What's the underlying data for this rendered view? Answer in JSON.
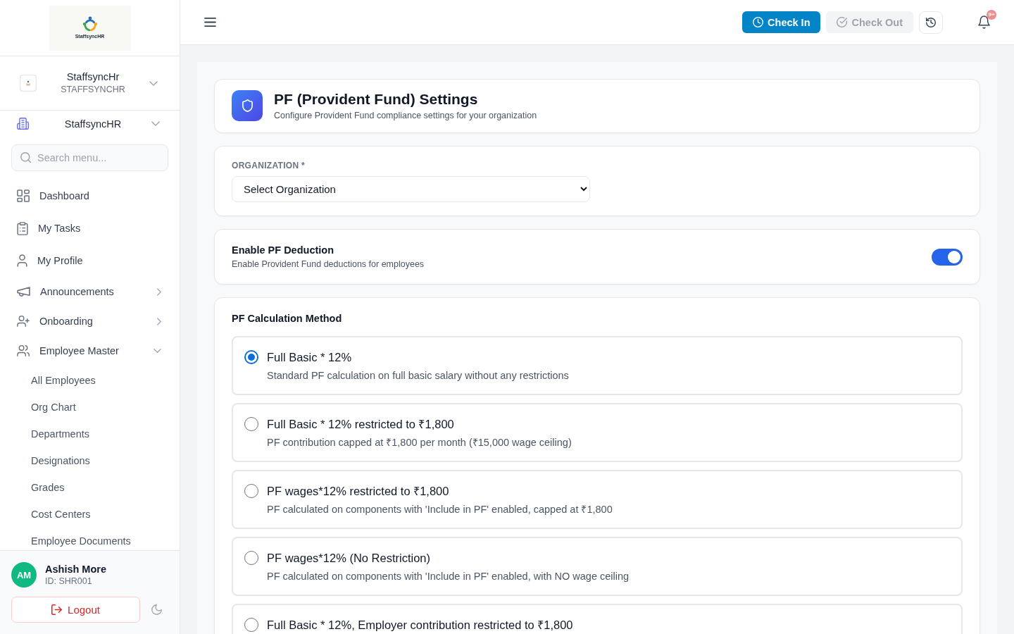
{
  "sidebar": {
    "logo": {
      "text": "StaffsyncHR"
    },
    "organization": {
      "name": "StaffsyncHr",
      "code": "STAFFSYNCHR"
    },
    "company": {
      "name": "StaffsyncHR"
    },
    "search": {
      "placeholder": "Search menu..."
    },
    "nav": [
      {
        "label": "Dashboard",
        "kind": "link"
      },
      {
        "label": "My Tasks",
        "kind": "link"
      },
      {
        "label": "My Profile",
        "kind": "link"
      },
      {
        "label": "Announcements",
        "kind": "group",
        "expanded": false
      },
      {
        "label": "Onboarding",
        "kind": "group",
        "expanded": false
      },
      {
        "label": "Employee Master",
        "kind": "group",
        "expanded": true,
        "children": [
          {
            "label": "All Employees"
          },
          {
            "label": "Org Chart"
          },
          {
            "label": "Departments"
          },
          {
            "label": "Designations"
          },
          {
            "label": "Grades"
          },
          {
            "label": "Cost Centers"
          },
          {
            "label": "Employee Documents"
          }
        ]
      }
    ],
    "user": {
      "initials": "AM",
      "name": "Ashish More",
      "id": "ID: SHR001"
    },
    "logout": {
      "label": "Logout"
    }
  },
  "header": {
    "check_in": {
      "label": "Check In",
      "disabled": false
    },
    "check_out": {
      "label": "Check Out",
      "disabled": true
    },
    "notifications": {
      "badge": "9+"
    }
  },
  "page_header": {
    "title": "PF (Provident Fund) Settings",
    "subtitle": "Configure Provident Fund compliance settings for your organization"
  },
  "organization_field": {
    "label": "ORGANIZATION *",
    "value": "Select Organization"
  },
  "pf_deduction": {
    "title": "Enable PF Deduction",
    "description": "Enable Provident Fund deductions for employees",
    "on": true
  },
  "calculation_method": {
    "title": "PF Calculation Method",
    "options": [
      {
        "title": "Full Basic * 12%",
        "description": "Standard PF calculation on full basic salary without any restrictions",
        "selected": true
      },
      {
        "title": "Full Basic * 12% restricted to ₹1,800",
        "description": "PF contribution capped at ₹1,800 per month (₹15,000 wage ceiling)",
        "selected": false
      },
      {
        "title": "PF wages*12% restricted to ₹1,800",
        "description": "PF calculated on components with 'Include in PF' enabled, capped at ₹1,800",
        "selected": false
      },
      {
        "title": "PF wages*12% (No Restriction)",
        "description": "PF calculated on components with 'Include in PF' enabled, with NO wage ceiling",
        "selected": false
      },
      {
        "title": "Full Basic * 12%, Employer contribution restricted to ₹1,800",
        "selected": false
      }
    ]
  }
}
